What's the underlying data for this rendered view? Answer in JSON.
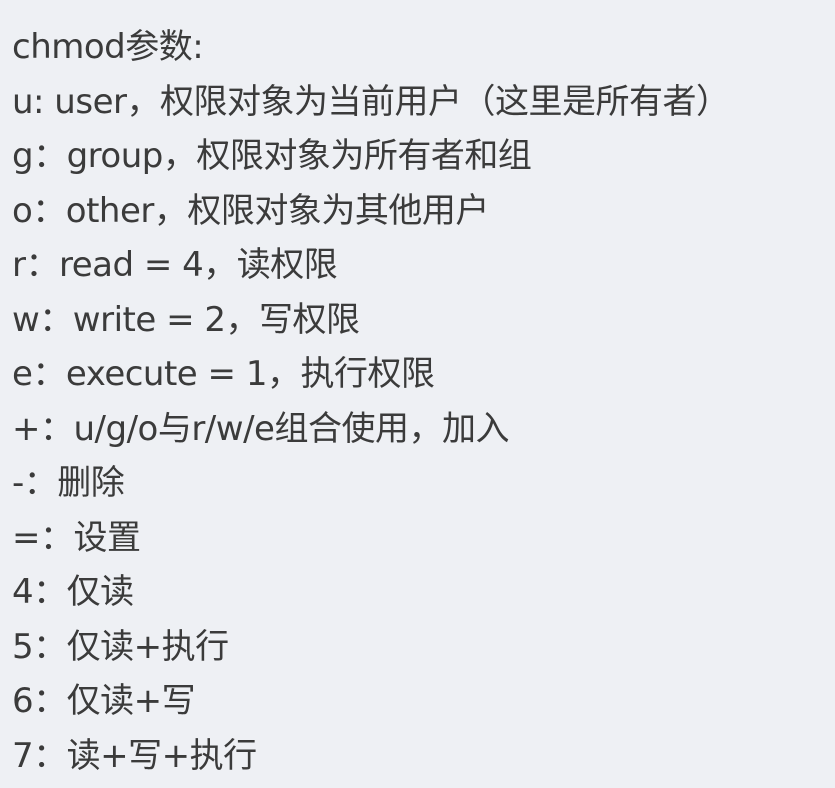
{
  "lines": [
    "chmod参数:",
    "u: user，权限对象为当前用户（这里是所有者）",
    "g：group，权限对象为所有者和组",
    "o：other，权限对象为其他用户",
    "r：read = 4，读权限",
    "w：write = 2，写权限",
    "e：execute = 1，执行权限",
    "+：u/g/o与r/w/e组合使用，加入",
    "-：删除",
    "=：设置",
    "4：仅读",
    "5：仅读+执行",
    "6：仅读+写",
    "7：读+写+执行"
  ]
}
